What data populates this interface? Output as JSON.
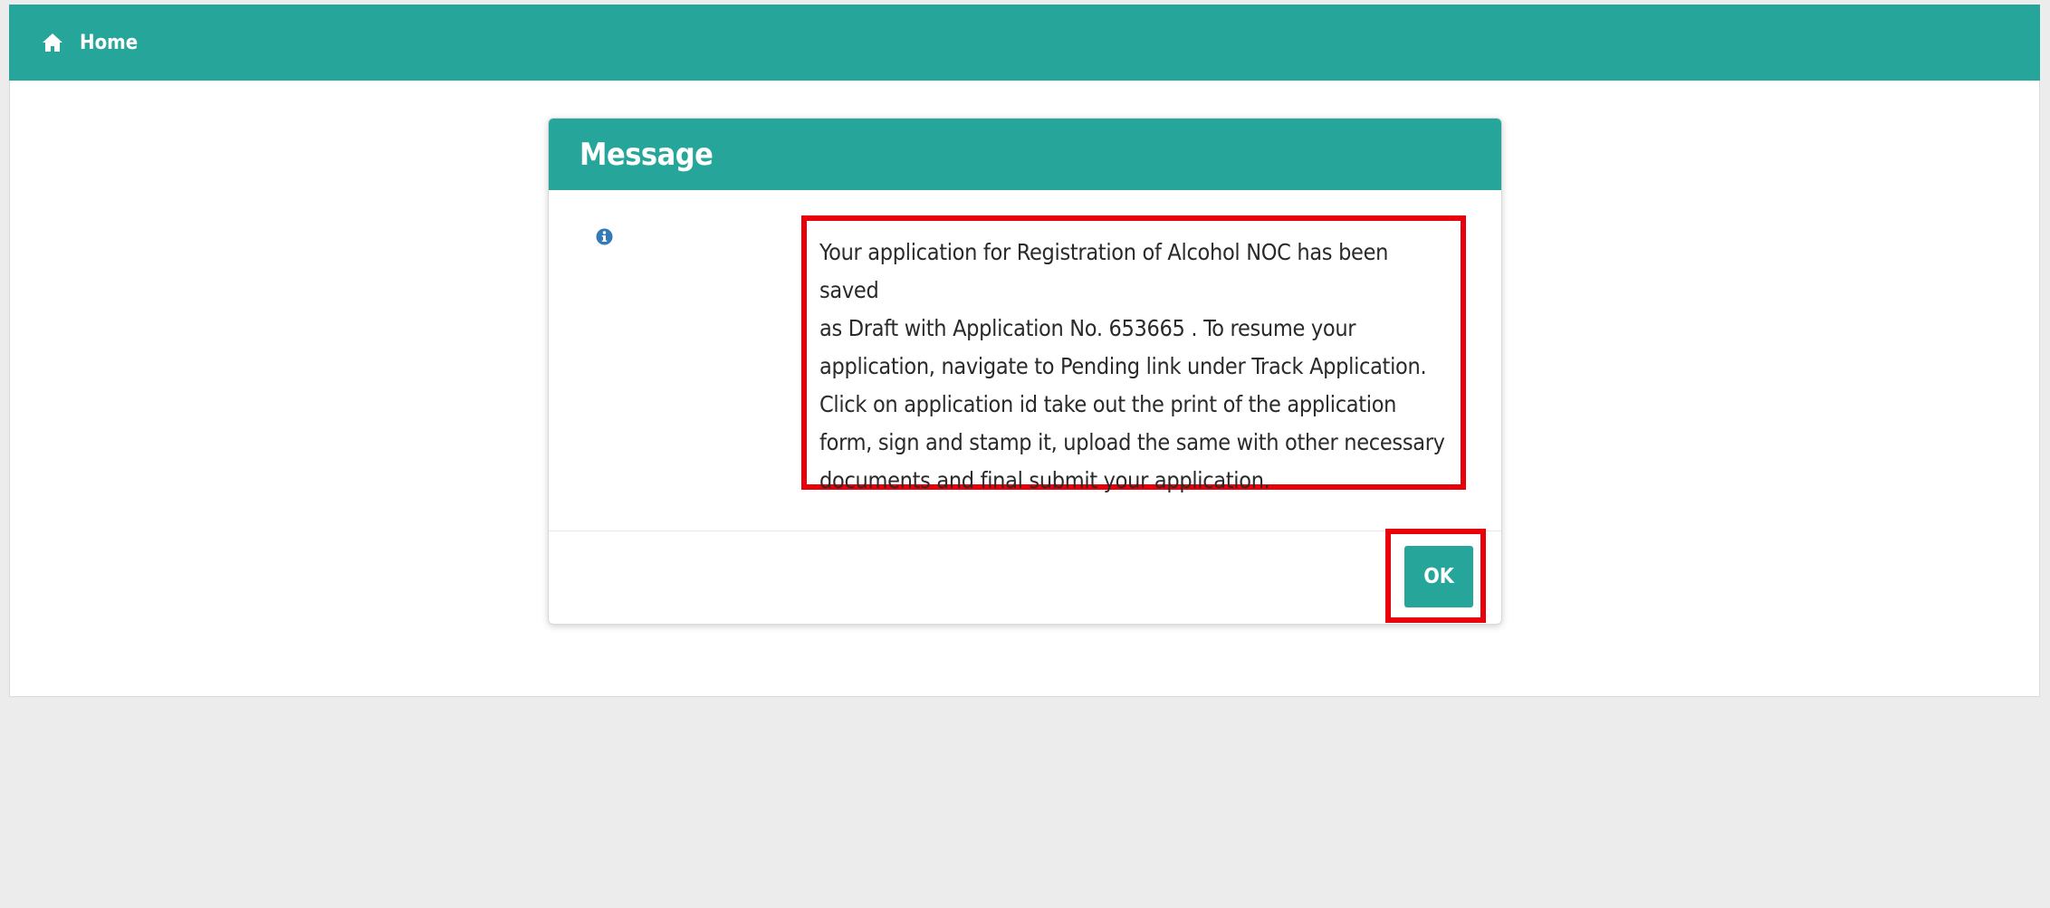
{
  "topbar": {
    "home_label": "Home",
    "home_icon": "home-icon",
    "color": "#26a69a"
  },
  "modal": {
    "title": "Message",
    "info_icon": "info-circle-icon",
    "message_lines": [
      "Your application for Registration of Alcohol NOC has been saved",
      "as Draft with Application No. 653665 . To resume your",
      "application, navigate to Pending link under Track Application.",
      "Click on application id take out the print of the application",
      "form, sign and stamp it, upload the same with other necessary",
      "documents and final submit your application."
    ],
    "ok_label": "OK",
    "highlight_color": "#e8000b"
  }
}
